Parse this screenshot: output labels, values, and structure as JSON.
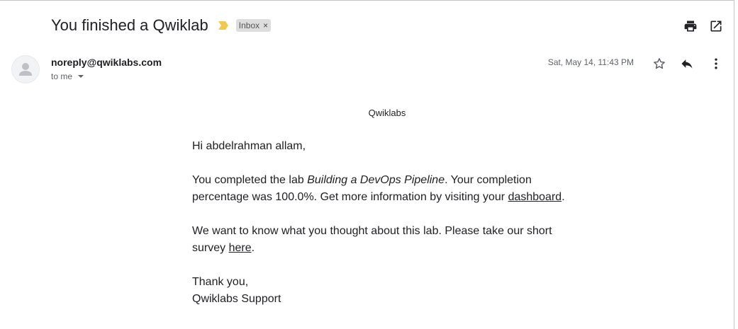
{
  "email": {
    "subject": "You finished a Qwiklab",
    "label": "Inbox",
    "label_remove": "×",
    "sender": "noreply@qwiklabs.com",
    "recipient": "to me",
    "date": "Sat, May 14, 11:43 PM"
  },
  "icons": {
    "importance": "importance-marker-icon",
    "print": "print-icon",
    "open_new_window": "open-in-new-window-icon",
    "avatar": "default-avatar-icon",
    "star": "star-icon",
    "reply": "reply-icon",
    "more": "more-vert-icon"
  },
  "colors": {
    "importance": "#f2c94c",
    "icon": "#202124",
    "chip_bg": "#dddddd"
  },
  "body": {
    "brand": "Qwiklabs",
    "greeting": "Hi abdelrahman allam,",
    "p1_pre": "You completed the lab ",
    "lab_name": "Building a DevOps Pipeline",
    "p1_mid": ". Your completion percentage was 100.0%. Get more information by visiting your ",
    "dashboard_link": "dashboard",
    "p1_end": ".",
    "p2_pre": "We want to know what you thought about this lab. Please take our short survey ",
    "survey_link": "here",
    "p2_end": ".",
    "signoff": "Thank you,",
    "signature": "Qwiklabs Support"
  }
}
